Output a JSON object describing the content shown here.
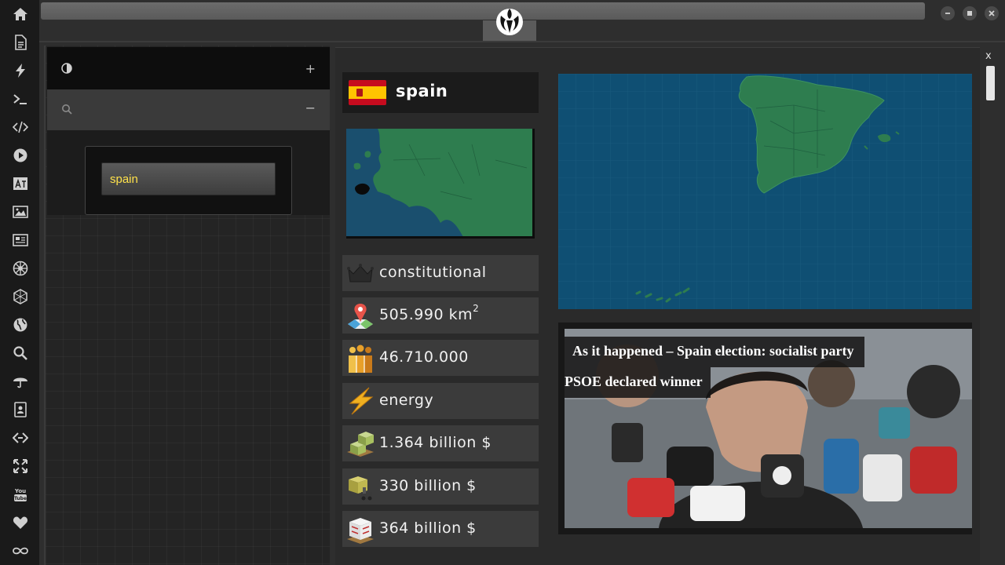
{
  "rail": {
    "icons": [
      "home-icon",
      "document-icon",
      "lightning-icon",
      "terminal-icon",
      "code-icon",
      "play-icon",
      "translate-icon",
      "image-icon",
      "newspaper-icon",
      "empire-icon",
      "hexagon-icon",
      "globe-icon",
      "search-icon",
      "umbrella-icon",
      "contacts-icon",
      "link-icon",
      "expand-icon",
      "youtube-icon",
      "heart-icon",
      "infinity-icon"
    ]
  },
  "search": {
    "value": "spain"
  },
  "main": {
    "close_label": "x",
    "country_name": "spain",
    "stats": [
      {
        "icon": "crown-icon",
        "value": "constitutional"
      },
      {
        "icon": "map-pin-icon",
        "value": "505.990 km",
        "sup": "2"
      },
      {
        "icon": "population-icon",
        "value": "46.710.000"
      },
      {
        "icon": "energy-icon",
        "value": "energy"
      },
      {
        "icon": "gdp-icon",
        "value": "1.364 billion $"
      },
      {
        "icon": "export-icon",
        "value": "330 billion $"
      },
      {
        "icon": "import-icon",
        "value": "364 billion $"
      }
    ],
    "news": {
      "headline_line1": "As it happened – Spain election: socialist party",
      "headline_line2": "PSOE declared winner"
    }
  },
  "colors": {
    "accent_text": "#ffe24a",
    "map_sea": "#0f4f73",
    "map_land": "#2e7d4f"
  }
}
